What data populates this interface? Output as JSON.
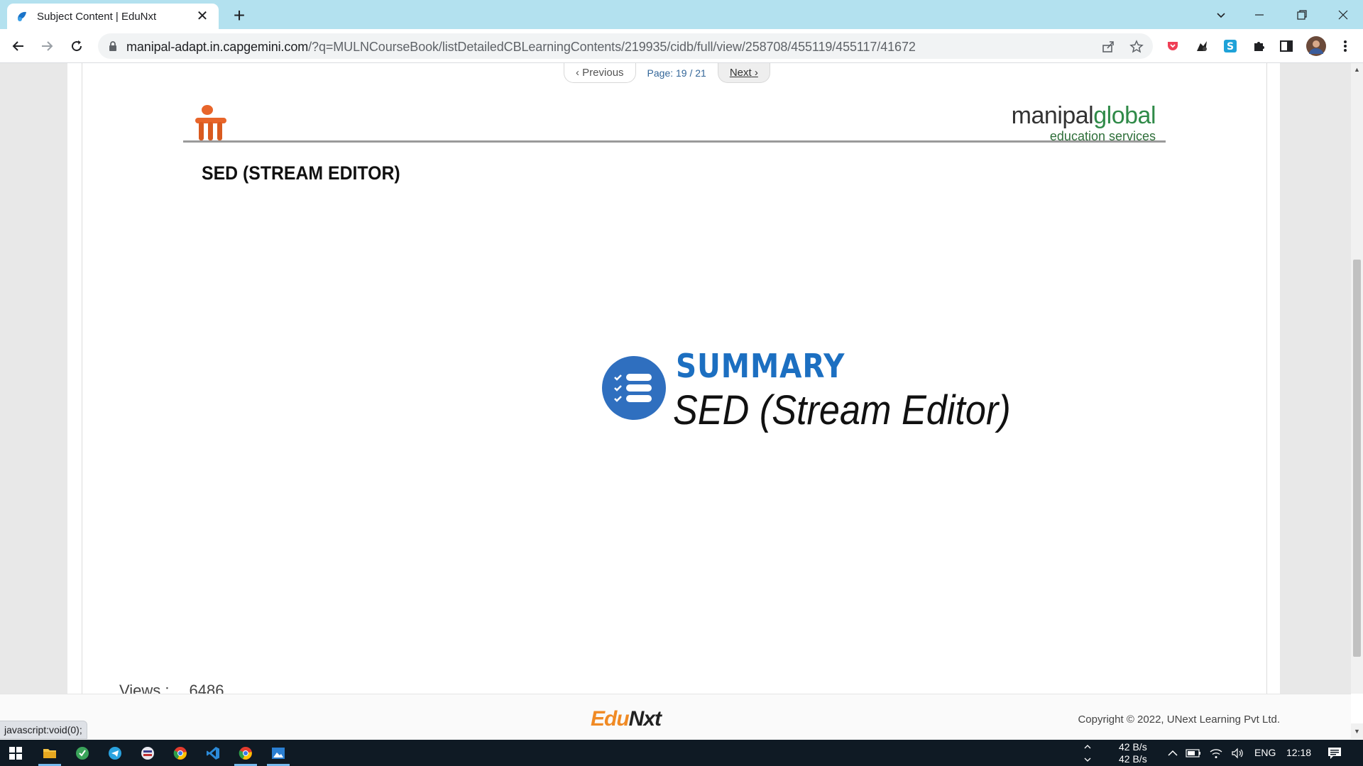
{
  "browser": {
    "tab_title": "Subject Content | EduNxt",
    "tab_close": "✕",
    "new_tab": "+",
    "url_host": "manipal-adapt.in.capgemini.com",
    "url_path": "/?q=MULNCourseBook/listDetailedCBLearningContents/219935/cidb/full/view/258708/455119/455117/41672"
  },
  "pager": {
    "previous": "Previous",
    "page_info": "Page: 19 / 21",
    "next": "Next"
  },
  "slide": {
    "brand_main_a": "manipal",
    "brand_main_b": "global",
    "brand_sub": "education services",
    "title": "SED (STREAM EDITOR)",
    "summary_label": "SUMMARY",
    "summary_subtitle": "SED (Stream Editor)"
  },
  "views": {
    "label": "Views :",
    "count": "6486"
  },
  "footer": {
    "logo_a": "Edu",
    "logo_b": "Nxt",
    "copyright": "Copyright © 2022, UNext Learning Pvt Ltd.",
    "status_text": "javascript:void(0);"
  },
  "taskbar": {
    "net_up": "42 B/s",
    "net_down": "42 B/s",
    "language": "ENG",
    "time": "12:18"
  },
  "colors": {
    "tab_strip": "#b3e1ef",
    "summary_blue": "#1c6fc1",
    "brand_green": "#2f8a48",
    "edunxt_orange": "#f08a24",
    "taskbar": "#0f1a24"
  }
}
